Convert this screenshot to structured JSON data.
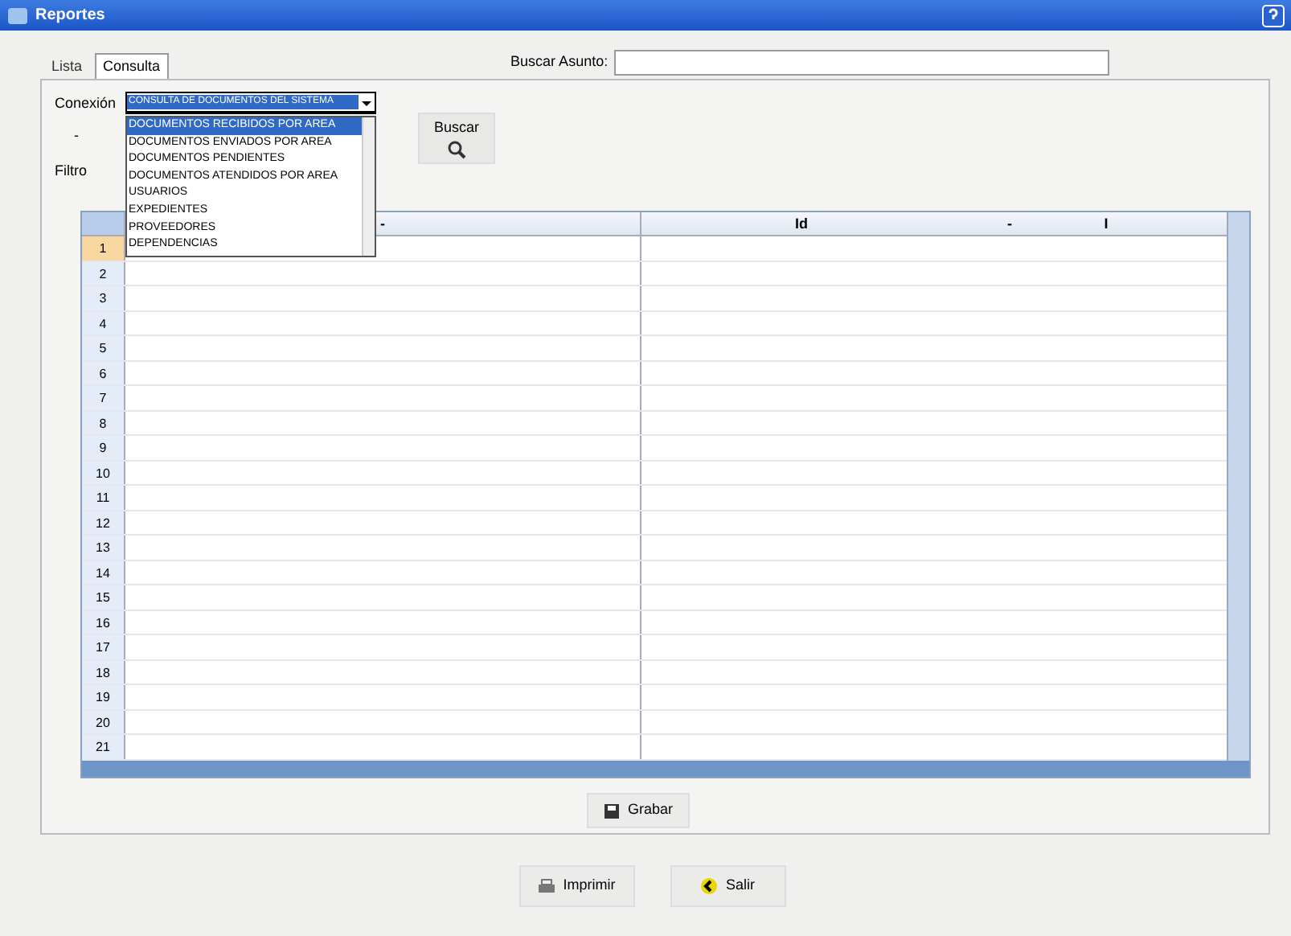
{
  "window": {
    "title": "Reportes"
  },
  "tabs": [
    {
      "label": "Lista",
      "selected": false
    },
    {
      "label": "Consulta",
      "selected": true
    }
  ],
  "search": {
    "label": "Buscar Asunto:"
  },
  "combo": {
    "label": "Conexión",
    "value": "CONSULTA DE DOCUMENTOS DEL SISTEMA",
    "expanded": true,
    "options": [
      {
        "label": "DOCUMENTOS RECIBIDOS POR AREA",
        "selected": true
      },
      {
        "label": "DOCUMENTOS ENVIADOS POR AREA",
        "selected": false
      },
      {
        "label": "DOCUMENTOS PENDIENTES",
        "selected": false
      },
      {
        "label": "DOCUMENTOS ATENDIDOS POR AREA",
        "selected": false
      },
      {
        "label": "USUARIOS",
        "selected": false
      },
      {
        "label": "EXPEDIENTES",
        "selected": false
      },
      {
        "label": "PROVEEDORES",
        "selected": false
      },
      {
        "label": "DEPENDENCIAS",
        "selected": false
      }
    ]
  },
  "side_labels": [
    "-",
    "Filtro"
  ],
  "find_button": {
    "label": "Buscar"
  },
  "table": {
    "columns": [
      "-",
      "Id",
      "-",
      "I"
    ],
    "rows": [
      {
        "number": "1",
        "selected": true
      },
      {
        "number": "2",
        "selected": false
      },
      {
        "number": "3",
        "selected": false
      },
      {
        "number": "4",
        "selected": false
      },
      {
        "number": "5",
        "selected": false
      },
      {
        "number": "6",
        "selected": false
      },
      {
        "number": "7",
        "selected": false
      },
      {
        "number": "8",
        "selected": false
      },
      {
        "number": "9",
        "selected": false
      },
      {
        "number": "10",
        "selected": false
      },
      {
        "number": "11",
        "selected": false
      },
      {
        "number": "12",
        "selected": false
      },
      {
        "number": "13",
        "selected": false
      },
      {
        "number": "14",
        "selected": false
      },
      {
        "number": "15",
        "selected": false
      },
      {
        "number": "16",
        "selected": false
      },
      {
        "number": "17",
        "selected": false
      },
      {
        "number": "18",
        "selected": false
      },
      {
        "number": "19",
        "selected": false
      },
      {
        "number": "20",
        "selected": false
      },
      {
        "number": "21",
        "selected": false
      }
    ]
  },
  "grid_button": {
    "label": "Grabar"
  },
  "footer_buttons": [
    {
      "kind": "print",
      "label": "Imprimir"
    },
    {
      "kind": "exit",
      "label": "Salir"
    }
  ]
}
